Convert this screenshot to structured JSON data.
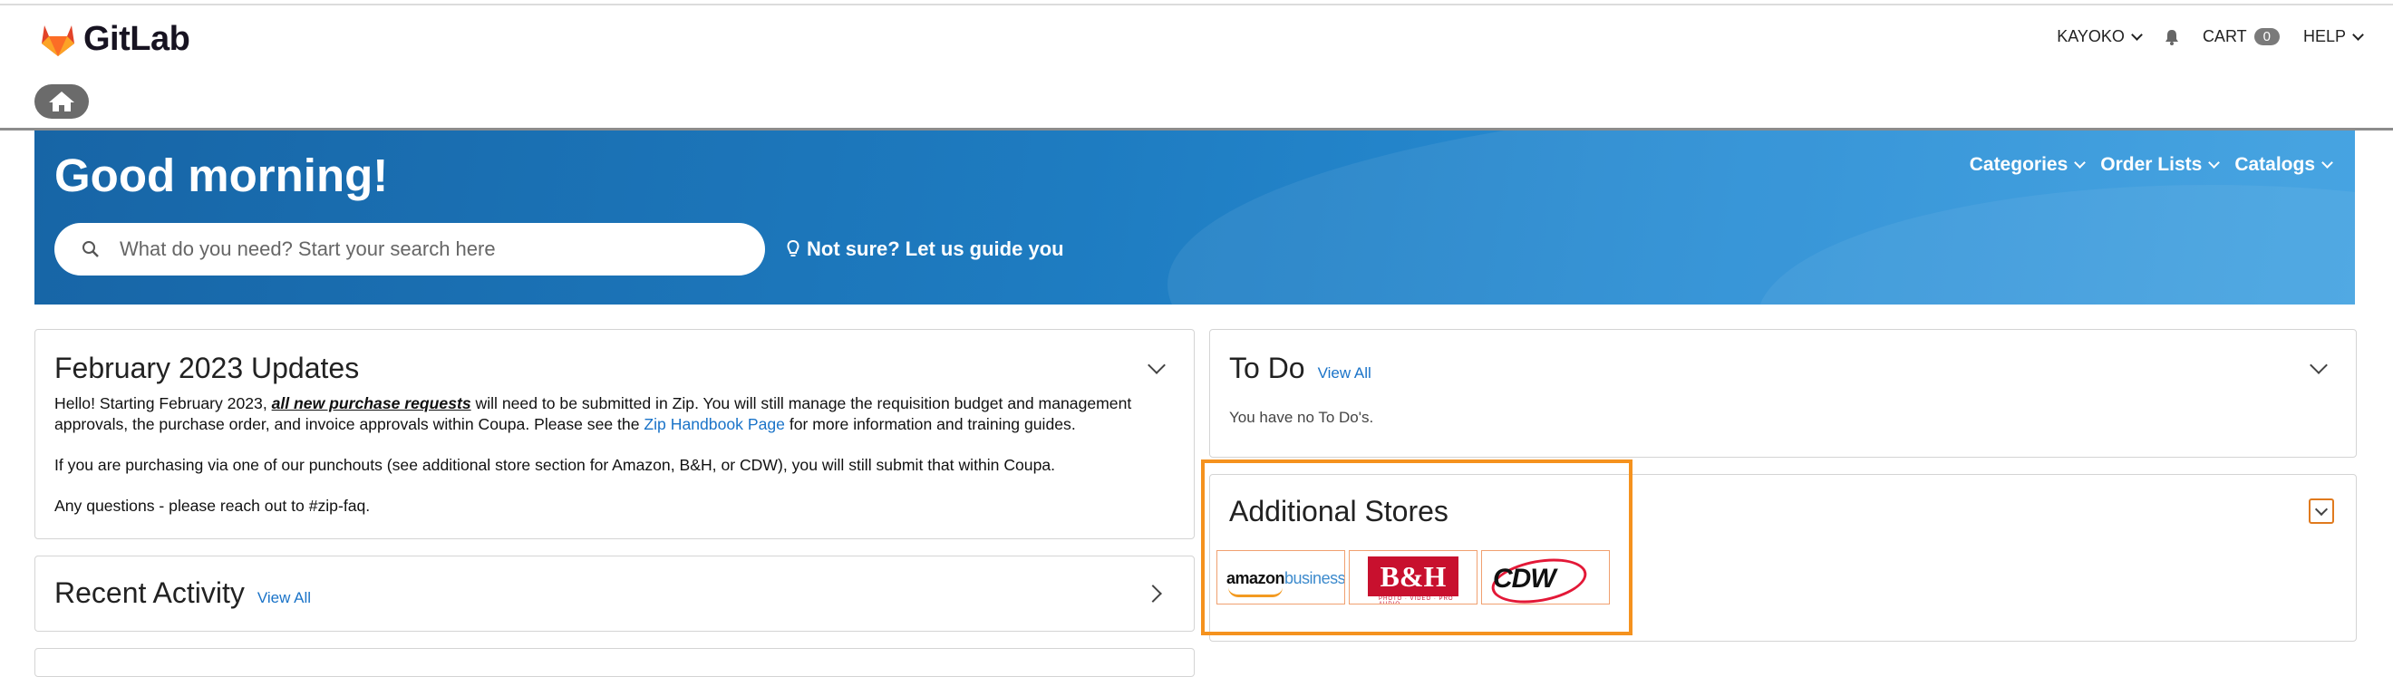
{
  "header": {
    "logo_text": "GitLab",
    "nav": {
      "user": "KAYOKO",
      "cart_label": "CART",
      "cart_count": "0",
      "help": "HELP"
    }
  },
  "banner": {
    "greeting": "Good morning!",
    "search_placeholder": "What do you need? Start your search here",
    "guide_text": "Not sure? Let us guide you",
    "menu": [
      "Categories",
      "Order Lists",
      "Catalogs"
    ]
  },
  "updates": {
    "title": "February 2023 Updates",
    "p1_a": "Hello! Starting February 2023, ",
    "p1_bold": "all new purchase requests",
    "p1_b": " will need to be submitted in Zip. You will still manage the requisition budget and management approvals, the purchase order, and invoice approvals within Coupa. Please see the ",
    "p1_link": "Zip Handbook Page",
    "p1_c": " for more information and training guides.",
    "p2": "If you are purchasing via one of our punchouts (see additional store section for Amazon, B&H, or CDW), you will still submit that within Coupa.",
    "p3": "Any questions - please reach out to #zip-faq."
  },
  "recent": {
    "title": "Recent Activity",
    "view_all": "View All"
  },
  "todo": {
    "title": "To Do",
    "view_all": "View All",
    "empty": "You have no To Do's."
  },
  "stores": {
    "title": "Additional Stores",
    "items": [
      {
        "name": "amazon",
        "suffix": "business"
      },
      {
        "name": "B&H",
        "sub": "PHOTO · VIDEO · PRO AUDIO"
      },
      {
        "name": "CDW"
      }
    ]
  },
  "colors": {
    "banner": "#1e7cc1",
    "accent": "#f5921e",
    "link": "#1a73c8"
  }
}
